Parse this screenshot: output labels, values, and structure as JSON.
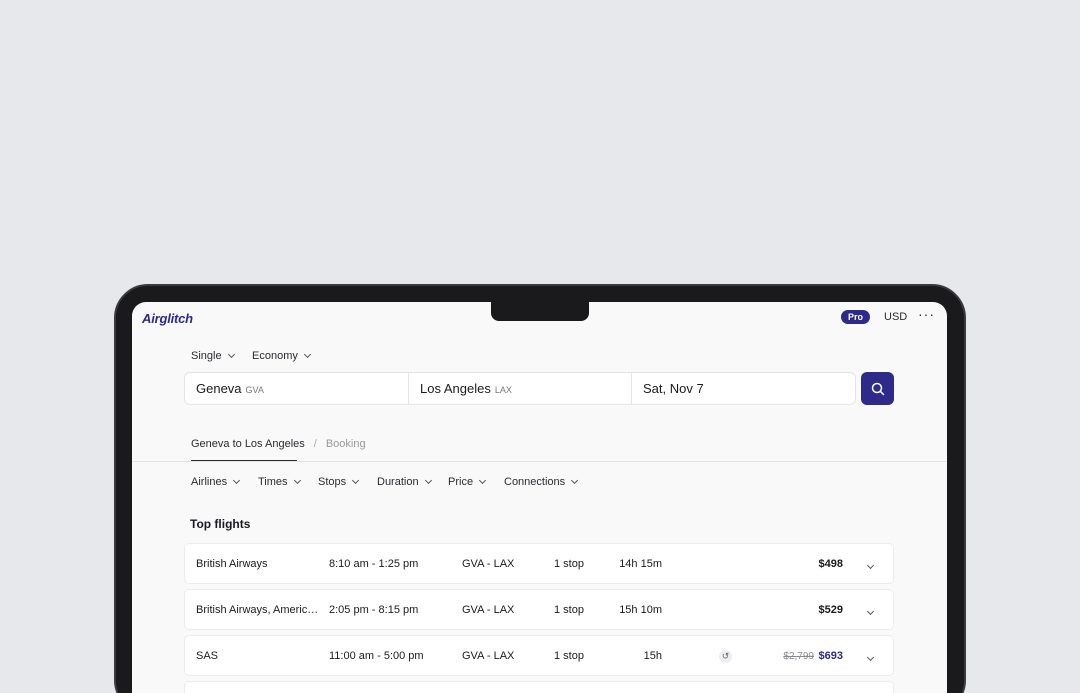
{
  "app": {
    "logo": "Airglitch",
    "badge": "Pro",
    "currency": "USD",
    "more": "···"
  },
  "search": {
    "trip_type": "Single",
    "cabin": "Economy",
    "origin": {
      "city": "Geneva",
      "code": "GVA"
    },
    "destination": {
      "city": "Los Angeles",
      "code": "LAX"
    },
    "date": "Sat, Nov 7"
  },
  "breadcrumb": {
    "current": "Geneva to Los Angeles",
    "separator": "/",
    "next": "Booking"
  },
  "filters": [
    "Airlines",
    "Times",
    "Stops",
    "Duration",
    "Price",
    "Connections"
  ],
  "section_title": "Top flights",
  "flights": [
    {
      "airline": "British Airways",
      "time": "8:10 am - 1:25 pm",
      "route": "GVA - LAX",
      "stops": "1 stop",
      "duration": "14h 15m",
      "price": "$498"
    },
    {
      "airline": "British Airways, American Airlines",
      "time": "2:05 pm - 8:15 pm",
      "route": "GVA - LAX",
      "stops": "1 stop",
      "duration": "15h 10m",
      "price": "$529"
    },
    {
      "airline": "SAS",
      "time": "11:00 am - 5:00 pm",
      "route": "GVA - LAX",
      "stops": "1 stop",
      "duration": "15h",
      "old_price": "$2,799",
      "price": "$693"
    }
  ],
  "colors": {
    "accent": "#2e2a8a",
    "background": "#e7e8ec",
    "screen": "#f9f9fa"
  }
}
